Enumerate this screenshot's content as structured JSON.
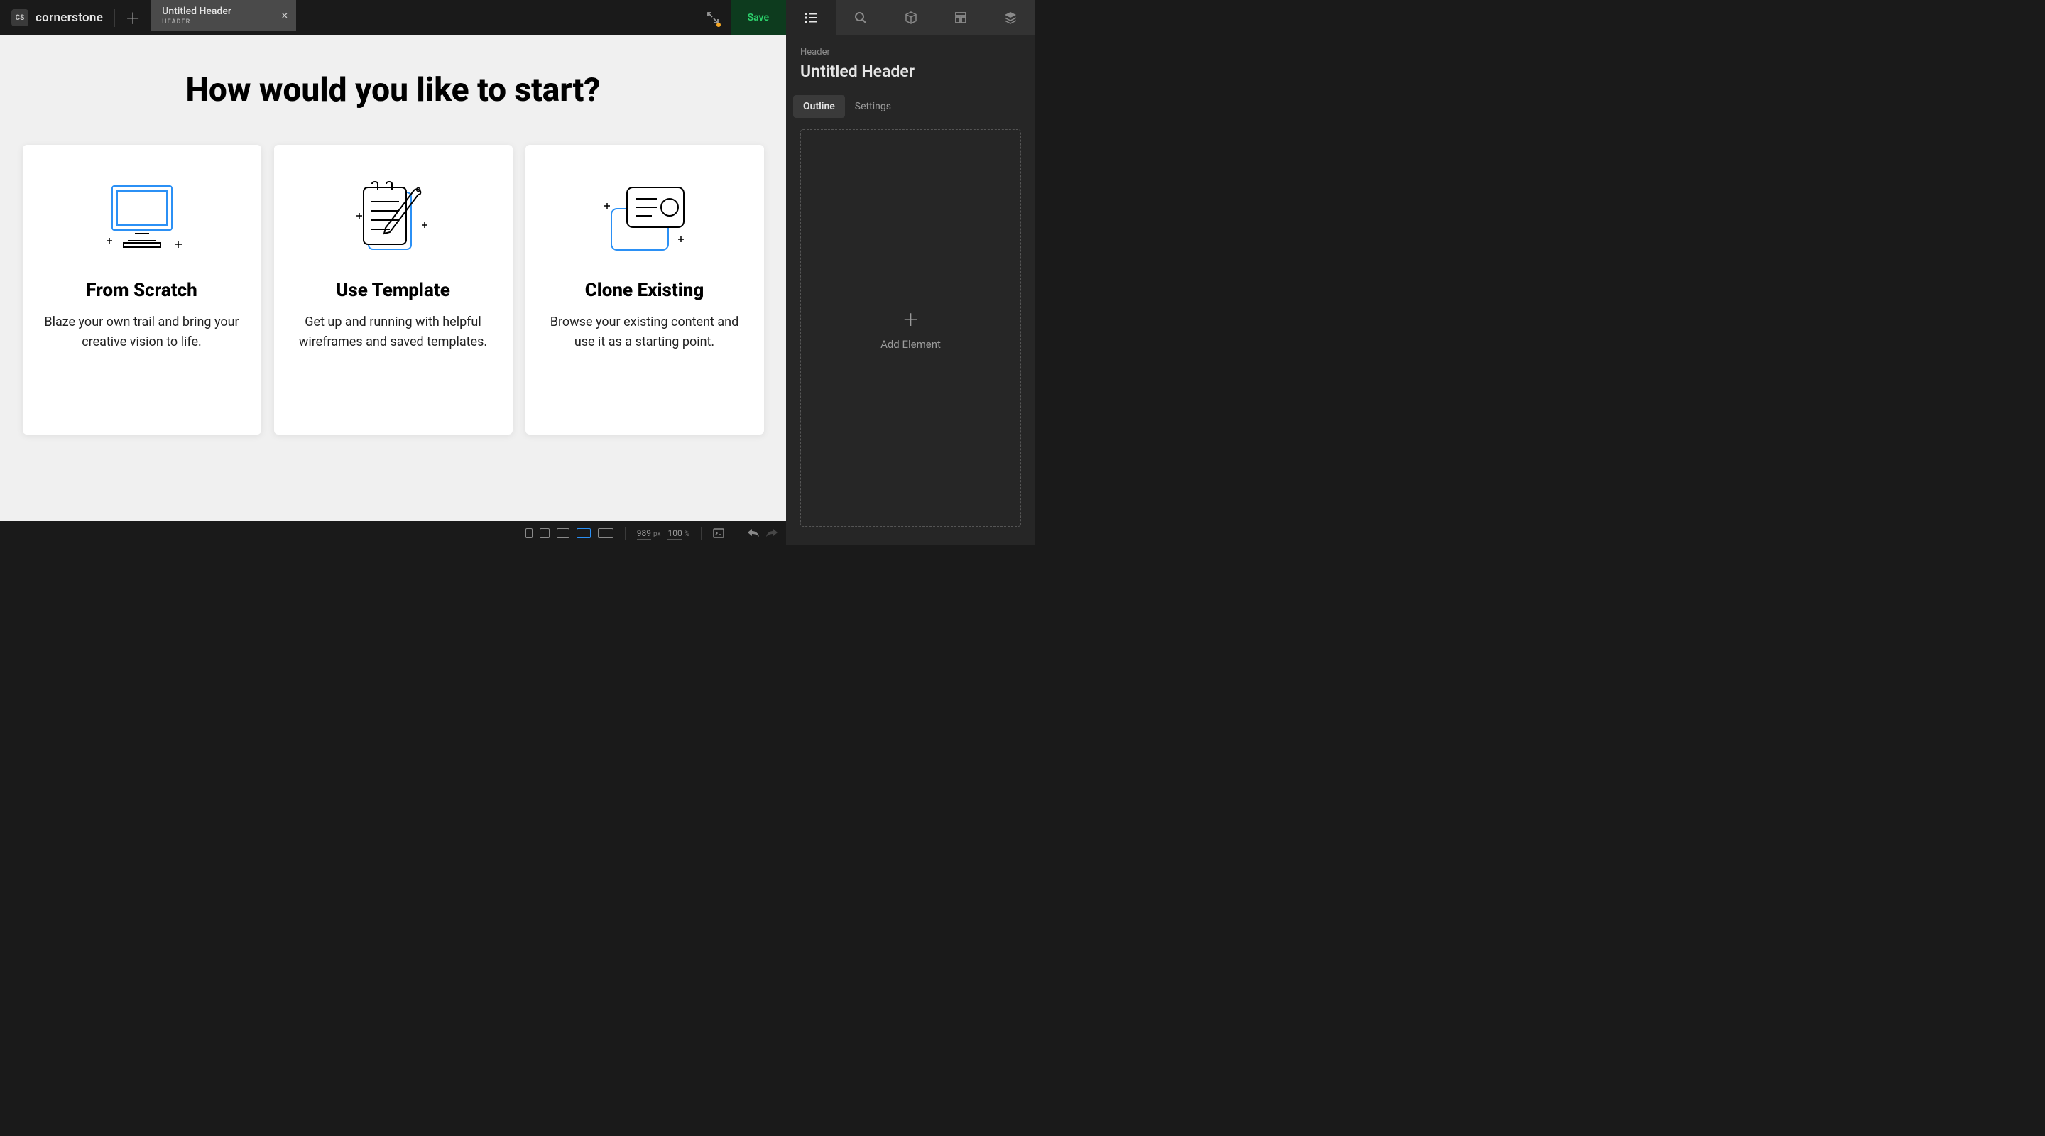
{
  "brand": {
    "logo": "CS",
    "name": "cornerstone"
  },
  "tab": {
    "title": "Untitled Header",
    "subtitle": "HEADER"
  },
  "save_label": "Save",
  "main": {
    "heading": "How would you like to start?",
    "options": [
      {
        "title": "From Scratch",
        "desc": "Blaze your own trail and bring your creative vision to life."
      },
      {
        "title": "Use Template",
        "desc": "Get up and running with helpful wireframes and saved templates."
      },
      {
        "title": "Clone Existing",
        "desc": "Browse your existing content and use it as a starting point."
      }
    ]
  },
  "statusbar": {
    "width": "989",
    "width_unit": "px",
    "zoom": "100",
    "zoom_unit": "%"
  },
  "inspector": {
    "breadcrumb": "Header",
    "title": "Untitled Header",
    "subtabs": [
      "Outline",
      "Settings"
    ],
    "drop_label": "Add Element"
  }
}
